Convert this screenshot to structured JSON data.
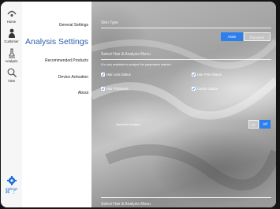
{
  "sidebar": {
    "items": [
      {
        "label": "Home",
        "icon": "home-icon"
      },
      {
        "label": "Customer",
        "icon": "customer-icon"
      },
      {
        "label": "Analysis",
        "icon": "analysis-icon"
      },
      {
        "label": "View",
        "icon": "search-icon"
      }
    ],
    "settings_label": "Settings",
    "settings_icon": "gear-icon",
    "status_icons": "wifi-icon, signal-icon"
  },
  "menu": {
    "items": [
      "General Settings",
      "Analysis Settings",
      "Recommended Products",
      "Device Activation",
      "About"
    ],
    "selected": "Analysis Settings"
  },
  "panel": {
    "skin_type": {
      "title": "Skin Type",
      "options": [
        "Asian",
        "European"
      ],
      "selected": "Asian"
    },
    "hair_menu": {
      "title": "Select Hair & Analysis Menu",
      "hint": "It is only available to analyze the parameters marked.",
      "items": [
        {
          "label": "Hair Loss Status",
          "checked": true
        },
        {
          "label": "Hair Pore Status",
          "checked": true
        },
        {
          "label": "Hair Thickness",
          "checked": true
        },
        {
          "label": "Cuticle Status",
          "checked": true
        }
      ]
    },
    "algorithm": {
      "label": "Algorithm Analysis",
      "options": [
        "On",
        "Off"
      ],
      "selected": "Off"
    },
    "bottom_title": "Select Hair & Analysis Menu"
  },
  "colors": {
    "accent": "#2d7ff0",
    "menu_selected": "#2f5ea8",
    "rail_background": "#f6f6f6"
  }
}
